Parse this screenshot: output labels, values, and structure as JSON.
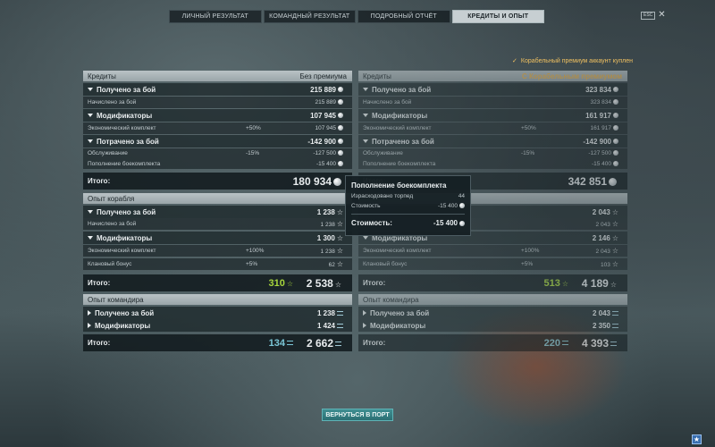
{
  "tabs": [
    {
      "label": "ЛИЧНЫЙ РЕЗУЛЬТАТ",
      "active": false
    },
    {
      "label": "КОМАНДНЫЙ РЕЗУЛЬТАТ",
      "active": false
    },
    {
      "label": "ПОДРОБНЫЙ ОТЧЁТ",
      "active": false
    },
    {
      "label": "КРЕДИТЫ И ОПЫТ",
      "active": true
    }
  ],
  "esc_label": "ESC",
  "premium_note": "Корабельный премиум аккаунт куплен",
  "left": {
    "credits_header": "Кредиты",
    "credits_subheader": "Без премиума",
    "earned_label": "Получено за бой",
    "earned_value": "215 889",
    "accrued_label": "Начислено за бой",
    "accrued_value": "215 889",
    "modifiers_label": "Модификаторы",
    "modifiers_value": "107 945",
    "econ_label": "Экономический комплект",
    "econ_pct": "+50%",
    "econ_value": "107 945",
    "spent_label": "Потрачено за бой",
    "spent_value": "-142 900",
    "service_label": "Обслуживание",
    "service_pct": "-15%",
    "service_value": "-127 500",
    "ammo_label": "Пополнение боекомплекта",
    "ammo_value": "-15 400",
    "total_label": "Итого:",
    "credits_total": "180 934",
    "ship_xp_header": "Опыт корабля",
    "ship_earned_label": "Получено за бой",
    "ship_earned_value": "1 238",
    "ship_accrued_label": "Начислено за бой",
    "ship_accrued_value": "1 238",
    "ship_mod_label": "Модификаторы",
    "ship_mod_value": "1 300",
    "ship_econ_label": "Экономический комплект",
    "ship_econ_pct": "+100%",
    "ship_econ_value": "1 238",
    "clan_label": "Клановый бонус",
    "clan_pct": "+5%",
    "clan_value": "62",
    "ship_free_xp": "310",
    "ship_total": "2 538",
    "cmd_header": "Опыт командира",
    "cmd_earned_label": "Получено за бой",
    "cmd_earned_value": "1 238",
    "cmd_mod_label": "Модификаторы",
    "cmd_mod_value": "1 424",
    "cmd_elite": "134",
    "cmd_total": "2 662"
  },
  "right": {
    "credits_header": "Кредиты",
    "credits_subheader": "С Корабельным премиумом",
    "earned_label": "Получено за бой",
    "earned_value": "323 834",
    "accrued_label": "Начислено за бой",
    "accrued_value": "323 834",
    "modifiers_label": "Модификаторы",
    "modifiers_value": "161 917",
    "econ_label": "Экономический комплект",
    "econ_pct": "+50%",
    "econ_value": "161 917",
    "spent_label": "Потрачено за бой",
    "spent_value": "-142 900",
    "service_label": "Обслуживание",
    "service_pct": "-15%",
    "service_value": "-127 500",
    "ammo_label": "Пополнение боекомплекта",
    "ammo_value": "-15 400",
    "total_label": "Итого:",
    "credits_total": "342 851",
    "ship_earned_value": "2 043",
    "ship_accrued_value": "2 043",
    "ship_mod_label": "Модификаторы",
    "ship_mod_value": "2 146",
    "ship_econ_label": "Экономический комплект",
    "ship_econ_pct": "+100%",
    "ship_econ_value": "2 043",
    "clan_label": "Клановый бонус",
    "clan_pct": "+5%",
    "clan_value": "103",
    "ship_free_xp": "513",
    "ship_total": "4 189",
    "cmd_header": "Опыт командира",
    "cmd_earned_label": "Получено за бой",
    "cmd_earned_value": "2 043",
    "cmd_mod_label": "Модификаторы",
    "cmd_mod_value": "2 350",
    "cmd_elite": "220",
    "cmd_total": "4 393"
  },
  "tooltip": {
    "title": "Пополнение боекомплекта",
    "torpedo_label": "Израсходовано торпед",
    "torpedo_value": "44",
    "cost_label": "Стоимость",
    "cost_value": "-15 400",
    "total_label": "Стоимость:",
    "total_value": "-15 400"
  },
  "back_button": "ВЕРНУТЬСЯ В ПОРТ",
  "icons": {
    "coin": "credits-icon",
    "star": "xp-star-icon",
    "elite": "commander-xp-icon",
    "check": "check-icon"
  },
  "colors": {
    "free_xp": "#a7d63c",
    "elite_xp": "#7bc6d6",
    "premium_header": "#f0b54a",
    "accent_button": "#2b6f73"
  }
}
